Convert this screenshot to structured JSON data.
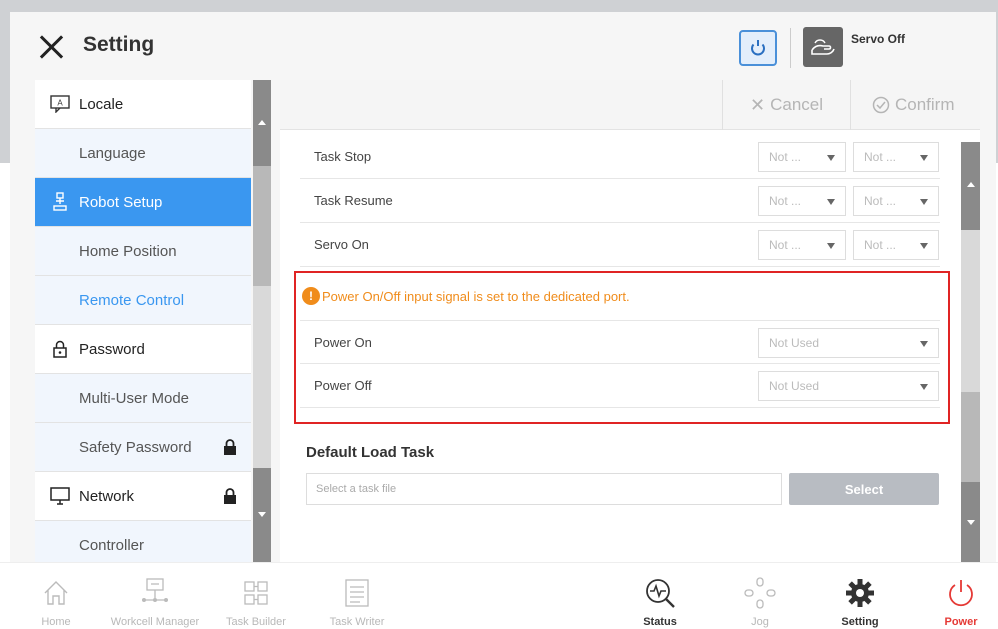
{
  "header": {
    "title": "Setting",
    "servo_label": "Servo Off"
  },
  "sidebar": {
    "items": [
      {
        "label": "Locale",
        "type": "parent",
        "icon": "locale-icon"
      },
      {
        "label": "Language",
        "type": "child"
      },
      {
        "label": "Robot Setup",
        "type": "active",
        "icon": "robot-icon"
      },
      {
        "label": "Home Position",
        "type": "child"
      },
      {
        "label": "Remote Control",
        "type": "link"
      },
      {
        "label": "Password",
        "type": "parent",
        "icon": "lock-icon"
      },
      {
        "label": "Multi-User Mode",
        "type": "child"
      },
      {
        "label": "Safety Password",
        "type": "child",
        "locked": true
      },
      {
        "label": "Network",
        "type": "parent",
        "icon": "monitor-icon",
        "locked": true
      },
      {
        "label": "Controller",
        "type": "child"
      }
    ]
  },
  "toolbar": {
    "cancel": "Cancel",
    "confirm": "Confirm"
  },
  "rows": [
    {
      "label": "Task Stop",
      "sel1": "Not ...",
      "sel2": "Not ..."
    },
    {
      "label": "Task Resume",
      "sel1": "Not ...",
      "sel2": "Not ..."
    },
    {
      "label": "Servo On",
      "sel1": "Not ...",
      "sel2": "Not ..."
    }
  ],
  "power_section": {
    "warning": "Power On/Off input signal is set to the dedicated port.",
    "warning_icon": "!",
    "rows": [
      {
        "label": "Power On",
        "value": "Not Used"
      },
      {
        "label": "Power Off",
        "value": "Not Used"
      }
    ]
  },
  "default_load": {
    "title": "Default Load Task",
    "placeholder": "Select a task file",
    "button": "Select"
  },
  "nav": {
    "home": "Home",
    "workcell": "Workcell Manager",
    "task_builder": "Task Builder",
    "task_writer": "Task Writer",
    "status": "Status",
    "jog": "Jog",
    "setting": "Setting",
    "power": "Power"
  },
  "colors": {
    "accent": "#3a97f0",
    "warning": "#f08c1b",
    "highlight_border": "#e02424",
    "power": "#e53935"
  }
}
